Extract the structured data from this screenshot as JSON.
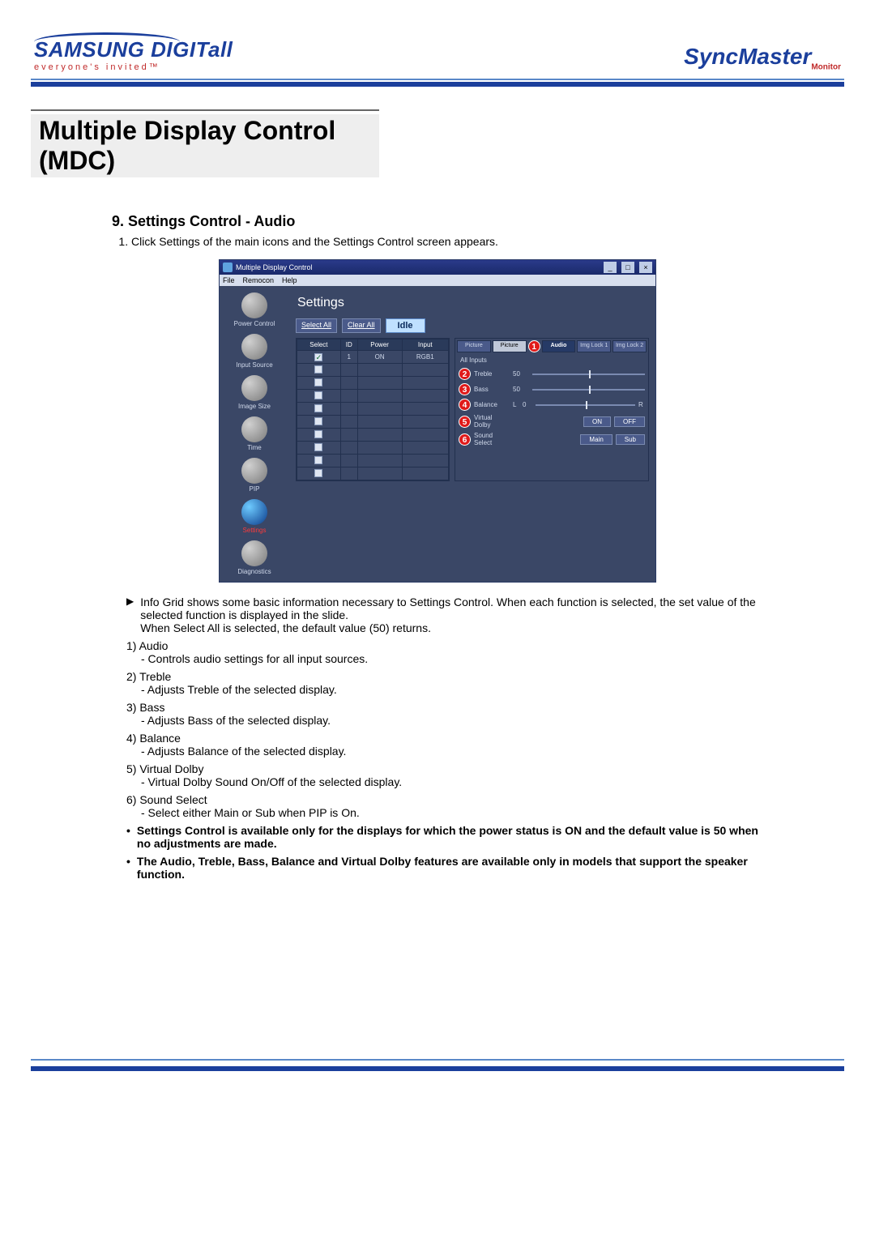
{
  "header": {
    "brand_left": "SAMSUNG DIGITall",
    "tagline": "everyone's invited™",
    "brand_right": "SyncMaster",
    "brand_right_sub": "Monitor"
  },
  "page_title": "Multiple Display Control (MDC)",
  "section": {
    "heading": "9. Settings Control - Audio",
    "intro_item": "Click Settings of the main icons and the Settings Control screen appears."
  },
  "app": {
    "title": "Multiple Display Control",
    "menus": [
      "File",
      "Remocon",
      "Help"
    ],
    "window_buttons": [
      "_",
      "□",
      "×"
    ],
    "sidebar": [
      {
        "label": "Power Control"
      },
      {
        "label": "Input Source"
      },
      {
        "label": "Image Size"
      },
      {
        "label": "Time"
      },
      {
        "label": "PIP"
      },
      {
        "label": "Settings",
        "active": true
      },
      {
        "label": "Diagnostics"
      }
    ],
    "panel_title": "Settings",
    "toolbar": {
      "select_all": "Select All",
      "clear_all": "Clear All",
      "idle": "Idle"
    },
    "grid": {
      "headers": [
        "Select",
        "ID",
        "Power",
        "Input"
      ],
      "row1": {
        "id": "1",
        "power": "ON",
        "input": "RGB1"
      }
    },
    "tabs": [
      "Picture",
      "Picture",
      "",
      "Audio",
      "Img Lock 1",
      "Img Lock 2"
    ],
    "all_inputs": "All Inputs",
    "rows": {
      "treble": {
        "num": "2",
        "label": "Treble",
        "val": "50"
      },
      "bass": {
        "num": "3",
        "label": "Bass",
        "val": "50"
      },
      "balance": {
        "num": "4",
        "label": "Balance",
        "left": "L",
        "val": "0",
        "right": "R"
      },
      "dolby": {
        "num": "5",
        "label": "Virtual Dolby",
        "on": "ON",
        "off": "OFF"
      },
      "sound": {
        "num": "6",
        "label": "Sound Select",
        "main": "Main",
        "sub": "Sub"
      }
    },
    "tab_marker": "1"
  },
  "desc": {
    "arrow_text": "Info Grid shows some basic information necessary to Settings Control. When each function is selected, the set value of the selected function is displayed in the slide.",
    "arrow_text2": "When Select All is selected, the default value (50) returns.",
    "items": [
      {
        "num": "1)",
        "title": "Audio",
        "sub": "- Controls audio settings for all input sources."
      },
      {
        "num": "2)",
        "title": "Treble",
        "sub": "- Adjusts Treble of the selected display."
      },
      {
        "num": "3)",
        "title": "Bass",
        "sub": "- Adjusts Bass of the selected display."
      },
      {
        "num": "4)",
        "title": "Balance",
        "sub": "- Adjusts Balance of the selected display."
      },
      {
        "num": "5)",
        "title": "Virtual Dolby",
        "sub": "- Virtual Dolby Sound On/Off of the selected display."
      },
      {
        "num": "6)",
        "title": "Sound Select",
        "sub": "- Select either Main or Sub when PIP is On."
      }
    ],
    "bullets": [
      "Settings Control is available only for the displays for which the power status is ON and the default value is 50 when no adjustments are made.",
      "The Audio, Treble, Bass, Balance and Virtual Dolby features are available only in models that support the speaker function."
    ]
  }
}
